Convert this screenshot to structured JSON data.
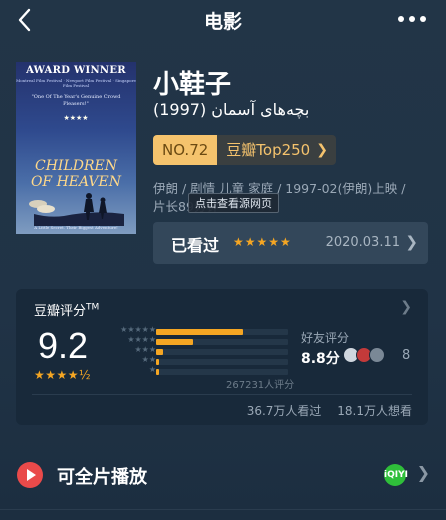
{
  "nav": {
    "title": "电影",
    "back_icon": "chevron-left-icon",
    "more_icon": "more-dots-icon"
  },
  "poster": {
    "award": "AWARD WINNER",
    "festivals": "Montreal Film Festival · Newport Film Festival · Singapore Film Festival",
    "quote": "\"One Of The Year's Genuine Crowd Pleasers!\"",
    "stars": "★★★★",
    "title_line1": "CHILDREN",
    "title_line2": "OF HEAVEN",
    "tagline": "A Little Secret.  Their Biggest Adventure!"
  },
  "movie": {
    "title": "小鞋子",
    "original_title": "بچه‌های آسمان (1997)",
    "rank_no": "NO.72",
    "rank_list": "豆瓣Top250",
    "meta_line1": "伊朗 / 剧情 儿童 家庭 / 1997-02(伊朗)上映 /",
    "meta_line2": "片长89分钟",
    "tooltip": "点击查看源网页"
  },
  "watched": {
    "label": "已看过",
    "stars": "★★★★★",
    "date": "2020.03.11"
  },
  "rating": {
    "title": "豆瓣评分",
    "tm": "TM",
    "score": "9.2",
    "stars": "★★★★½",
    "distribution": [
      {
        "stars": "★★★★★",
        "fraction": 0.66
      },
      {
        "stars": "★★★★",
        "fraction": 0.28
      },
      {
        "stars": "★★★",
        "fraction": 0.05
      },
      {
        "stars": "★★",
        "fraction": 0.01
      },
      {
        "stars": "★",
        "fraction": 0.01
      }
    ],
    "count": "267231人评分",
    "friend_label": "好友评分",
    "friend_score": "8.8分",
    "friend_count": "8",
    "watched_count": "36.7万人看过",
    "want_count": "18.1万人想看"
  },
  "play": {
    "label": "可全片播放",
    "source_badge": "iQIYI"
  },
  "colors": {
    "accent": "#f5a623",
    "rank_bg": "#f5c36d",
    "play_red": "#e94a4a",
    "source_green": "#2fbf3a"
  }
}
